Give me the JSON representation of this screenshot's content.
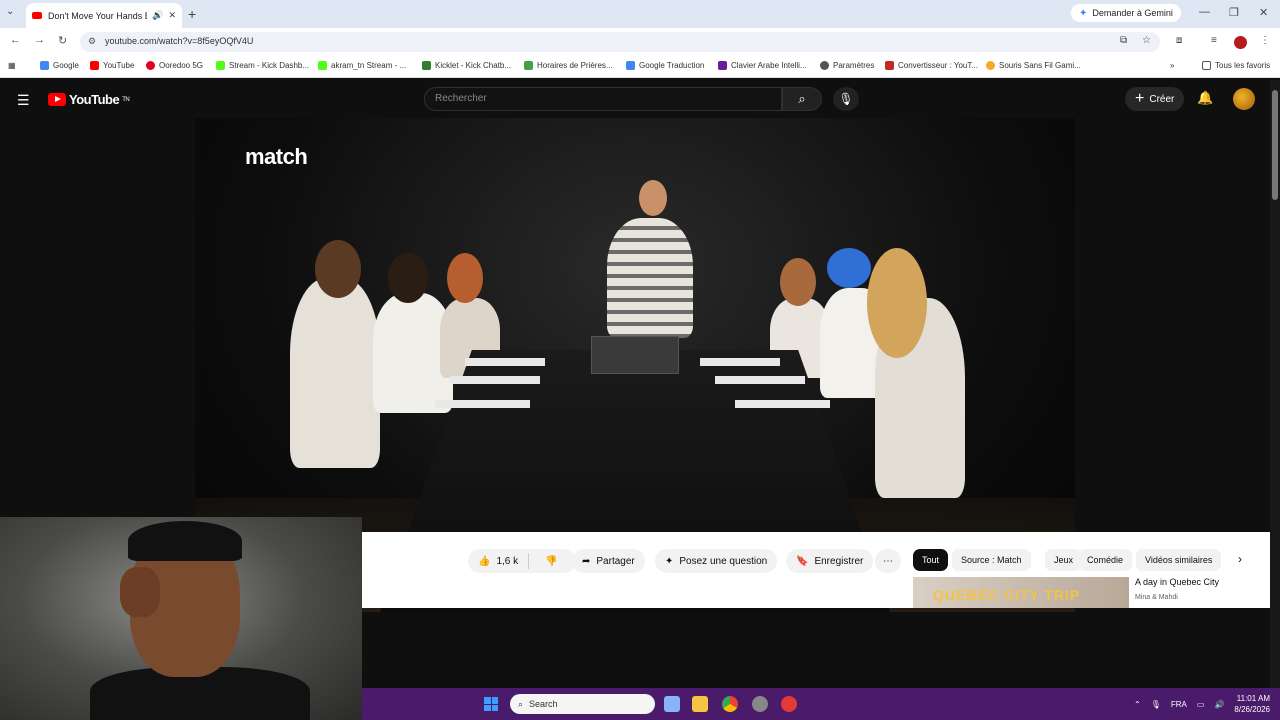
{
  "browser": {
    "tab_title": "Don't Move Your Hands Ep",
    "new_tab_symbol": "+",
    "gemini_label": "Demander à Gemini",
    "url": "youtube.com/watch?v=8f5eyOQfV4U",
    "bookmarks": [
      {
        "label": "Google",
        "color": "#4285f4"
      },
      {
        "label": "YouTube",
        "color": "#ff0000"
      },
      {
        "label": "Ooredoo 5G",
        "color": "#e2001a"
      },
      {
        "label": "Stream - Kick Dashb...",
        "color": "#53fc18"
      },
      {
        "label": "akram_tn Stream - ...",
        "color": "#53fc18"
      },
      {
        "label": "Kicklet - Kick Chatb...",
        "color": "#2e7d32"
      },
      {
        "label": "Horaires de Prières...",
        "color": "#43a047"
      },
      {
        "label": "Google Traduction",
        "color": "#4285f4"
      },
      {
        "label": "Clavier Arabe Intelli...",
        "color": "#6a1b9a"
      },
      {
        "label": "Paramètres",
        "color": "#555555"
      },
      {
        "label": "Convertisseur : YouT...",
        "color": "#c62828"
      },
      {
        "label": "Souris Sans Fil Gami...",
        "color": "#f9a825"
      }
    ],
    "all_bookmarks_label": "Tous les favoris"
  },
  "youtube": {
    "logo_text": "YouTube",
    "logo_region": "TN",
    "search_placeholder": "Rechercher",
    "create_label": "Créer",
    "video_brand": "match",
    "actions": {
      "likes": "1,6 k",
      "share": "Partager",
      "ask": "Posez une question",
      "save": "Enregistrer",
      "more": "⋯"
    },
    "chips": [
      "Tout",
      "Source : Match",
      "Jeux",
      "Comédie",
      "Vidéos similaires"
    ],
    "recommendation": {
      "title": "A day in Quebec City",
      "channel": "Mina & Mahdi",
      "thumb_text": "QUEBEC CITY TRIP"
    }
  },
  "taskbar": {
    "search_placeholder": "Search",
    "language": "FRA",
    "time": "11:01 AM",
    "date": "8/26/2026"
  },
  "colors": {
    "yt_red": "#ff0000",
    "yt_bg": "#0f0f0f",
    "taskbar": "#4a1b6b",
    "chrome_tabstrip": "#dfe7f5"
  }
}
